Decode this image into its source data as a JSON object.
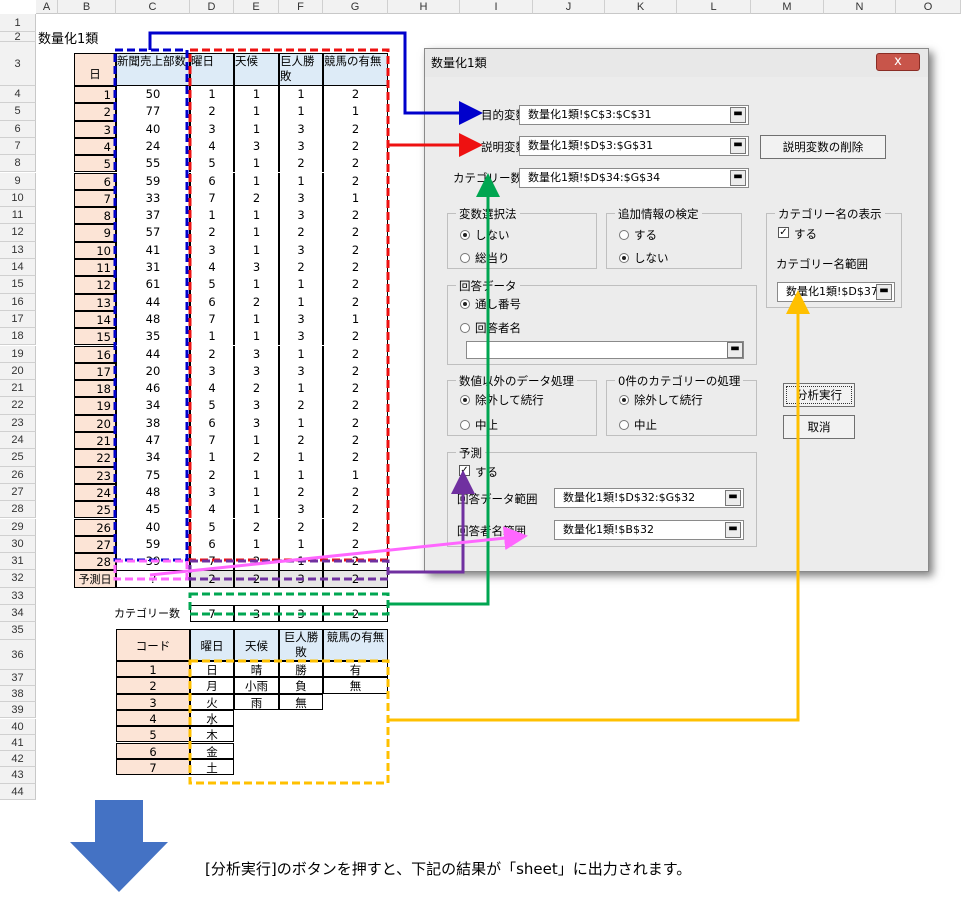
{
  "sheet_title": "数量化1類",
  "columns": [
    "A",
    "B",
    "C",
    "D",
    "E",
    "F",
    "G",
    "H",
    "I",
    "J",
    "K",
    "L",
    "M",
    "N",
    "O"
  ],
  "rows": [
    "1",
    "2",
    "3",
    "4",
    "5",
    "6",
    "7",
    "8",
    "9",
    "10",
    "11",
    "12",
    "13",
    "14",
    "15",
    "16",
    "17",
    "18",
    "19",
    "20",
    "21",
    "22",
    "23",
    "24",
    "25",
    "26",
    "27",
    "28",
    "29",
    "30",
    "31",
    "32",
    "33",
    "34",
    "35",
    "36",
    "37",
    "38",
    "39",
    "40",
    "41",
    "42",
    "43",
    "44"
  ],
  "table_headers": {
    "day": "日",
    "sales": "新聞売上部数",
    "weekday": "曜日",
    "weather": "天候",
    "giants": "巨人勝敗",
    "keiba": "競馬の有無"
  },
  "data_rows": [
    [
      "1",
      "50",
      "1",
      "1",
      "1",
      "2"
    ],
    [
      "2",
      "77",
      "2",
      "1",
      "1",
      "1"
    ],
    [
      "3",
      "40",
      "3",
      "1",
      "3",
      "2"
    ],
    [
      "4",
      "24",
      "4",
      "3",
      "3",
      "2"
    ],
    [
      "5",
      "55",
      "5",
      "1",
      "2",
      "2"
    ],
    [
      "6",
      "59",
      "6",
      "1",
      "1",
      "2"
    ],
    [
      "7",
      "33",
      "7",
      "2",
      "3",
      "1"
    ],
    [
      "8",
      "37",
      "1",
      "1",
      "3",
      "2"
    ],
    [
      "9",
      "57",
      "2",
      "1",
      "2",
      "2"
    ],
    [
      "10",
      "41",
      "3",
      "1",
      "3",
      "2"
    ],
    [
      "11",
      "31",
      "4",
      "3",
      "2",
      "2"
    ],
    [
      "12",
      "61",
      "5",
      "1",
      "1",
      "2"
    ],
    [
      "13",
      "44",
      "6",
      "2",
      "1",
      "2"
    ],
    [
      "14",
      "48",
      "7",
      "1",
      "3",
      "1"
    ],
    [
      "15",
      "35",
      "1",
      "1",
      "3",
      "2"
    ],
    [
      "16",
      "44",
      "2",
      "3",
      "1",
      "2"
    ],
    [
      "17",
      "20",
      "3",
      "3",
      "3",
      "2"
    ],
    [
      "18",
      "46",
      "4",
      "2",
      "1",
      "2"
    ],
    [
      "19",
      "34",
      "5",
      "3",
      "2",
      "2"
    ],
    [
      "20",
      "38",
      "6",
      "3",
      "1",
      "2"
    ],
    [
      "21",
      "47",
      "7",
      "1",
      "2",
      "2"
    ],
    [
      "22",
      "34",
      "1",
      "2",
      "1",
      "2"
    ],
    [
      "23",
      "75",
      "2",
      "1",
      "1",
      "1"
    ],
    [
      "24",
      "48",
      "3",
      "1",
      "2",
      "2"
    ],
    [
      "25",
      "45",
      "4",
      "1",
      "3",
      "2"
    ],
    [
      "26",
      "40",
      "5",
      "2",
      "2",
      "2"
    ],
    [
      "27",
      "59",
      "6",
      "1",
      "1",
      "2"
    ],
    [
      "28",
      "39",
      "7",
      "2",
      "1",
      "2"
    ]
  ],
  "predict_row": {
    "label": "予測日",
    "sales": "?",
    "values": [
      "2",
      "2",
      "3",
      "2"
    ]
  },
  "category_count": {
    "label": "カテゴリー数",
    "values": [
      "7",
      "3",
      "3",
      "2"
    ]
  },
  "code_table": {
    "headers": [
      "コード",
      "曜日",
      "天候",
      "巨人勝敗",
      "競馬の有無"
    ],
    "rows": [
      [
        "1",
        "日",
        "晴",
        "勝",
        "有"
      ],
      [
        "2",
        "月",
        "小雨",
        "負",
        "無"
      ],
      [
        "3",
        "火",
        "雨",
        "無",
        ""
      ],
      [
        "4",
        "水",
        "",
        "",
        ""
      ],
      [
        "5",
        "木",
        "",
        "",
        ""
      ],
      [
        "6",
        "金",
        "",
        "",
        ""
      ],
      [
        "7",
        "土",
        "",
        "",
        ""
      ]
    ]
  },
  "dialog": {
    "title": "数量化1類",
    "close": "x",
    "target_label": "目的変数",
    "target_value": "数量化1類!$C$3:$C$31",
    "explain_label": "説明変数",
    "explain_value": "数量化1類!$D$3:$G$31",
    "delete_button": "説明変数の削除",
    "category_label": "カテゴリー数",
    "category_value": "数量化1類!$D$34:$G$34",
    "var_select": {
      "title": "変数選択法",
      "opt1": "しない",
      "opt2": "総当り"
    },
    "add_info": {
      "title": "追加情報の検定",
      "opt1": "する",
      "opt2": "しない"
    },
    "cat_names": {
      "title": "カテゴリー名の表示",
      "check": "する",
      "range_label": "カテゴリー名範囲",
      "range_value": "数量化1類!$D$37"
    },
    "answer_data": {
      "title": "回答データ",
      "opt1": "通し番号",
      "opt2": "回答者名"
    },
    "non_numeric": {
      "title": "数値以外のデータ処理",
      "opt1": "除外して続行",
      "opt2": "中止"
    },
    "zero_cat": {
      "title": "0件のカテゴリーの処理",
      "opt1": "除外して続行",
      "opt2": "中止"
    },
    "run_button": "分析実行",
    "cancel_button": "取消",
    "predict": {
      "title": "予測",
      "check": "する",
      "range_label": "回答データ範囲",
      "range_value": "数量化1類!$D$32:$G$32",
      "name_label": "回答者名範囲",
      "name_value": "数量化1類!$B$32"
    }
  },
  "caption": "[分析実行]のボタンを押すと、下記の結果が「sheet」に出力されます。",
  "colors": {
    "blue": "#0000cc",
    "red": "#ee1111",
    "green": "#00a651",
    "purple": "#7030a0",
    "pink": "#ff66ff",
    "yellow": "#ffc000",
    "arrow_blue": "#4472c4",
    "day_bg": "#fce4d6",
    "header_bg": "#ddebf7"
  }
}
